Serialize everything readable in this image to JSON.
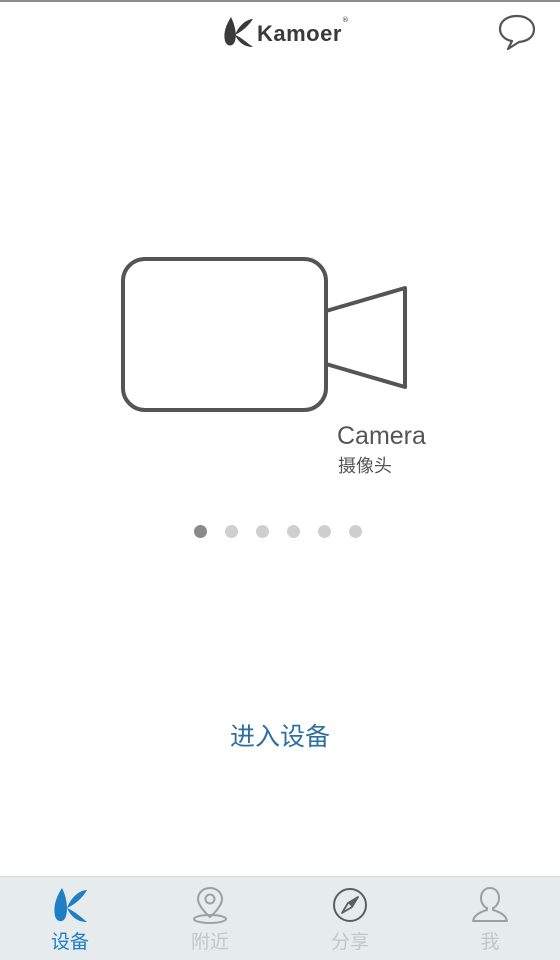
{
  "header": {
    "brand_name": "Kamoer",
    "brand_reg": "®",
    "message_icon": "chat-bubble-icon"
  },
  "carousel": {
    "slide": {
      "icon": "video-camera-icon",
      "title": "Camera",
      "subtitle": "摄像头"
    },
    "page_count": 6,
    "active_index": 0
  },
  "main": {
    "enter_label": "进入设备"
  },
  "tabbar": {
    "tabs": [
      {
        "label": "设备",
        "icon": "kamoer-logo-icon",
        "active": true
      },
      {
        "label": "附近",
        "icon": "location-pin-icon",
        "active": false
      },
      {
        "label": "分享",
        "icon": "compass-icon",
        "active": false
      },
      {
        "label": "我",
        "icon": "user-icon",
        "active": false
      }
    ]
  },
  "colors": {
    "accent": "#1f7fc4",
    "enter_text": "#2e6fa3",
    "tabbar_bg": "#e6ebed",
    "inactive": "#c3c7c9"
  }
}
